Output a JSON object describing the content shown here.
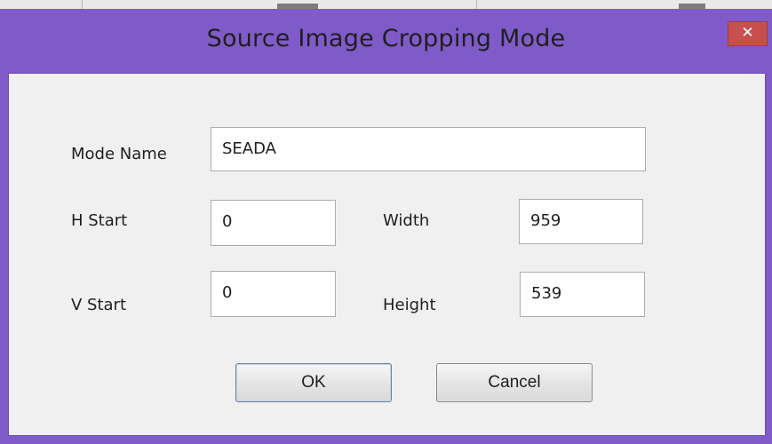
{
  "window": {
    "title": "Source Image Cropping Mode",
    "close_glyph": "✕",
    "accent_color": "#7f5bc9",
    "close_color": "#c7504f"
  },
  "form": {
    "mode_name_label": "Mode Name",
    "mode_name_value": "SEADA",
    "h_start_label": "H Start",
    "h_start_value": "0",
    "v_start_label": "V Start",
    "v_start_value": "0",
    "width_label": "Width",
    "width_value": "959",
    "height_label": "Height",
    "height_value": "539"
  },
  "buttons": {
    "ok_label": "OK",
    "cancel_label": "Cancel"
  },
  "icons": {
    "close": "close-icon"
  }
}
